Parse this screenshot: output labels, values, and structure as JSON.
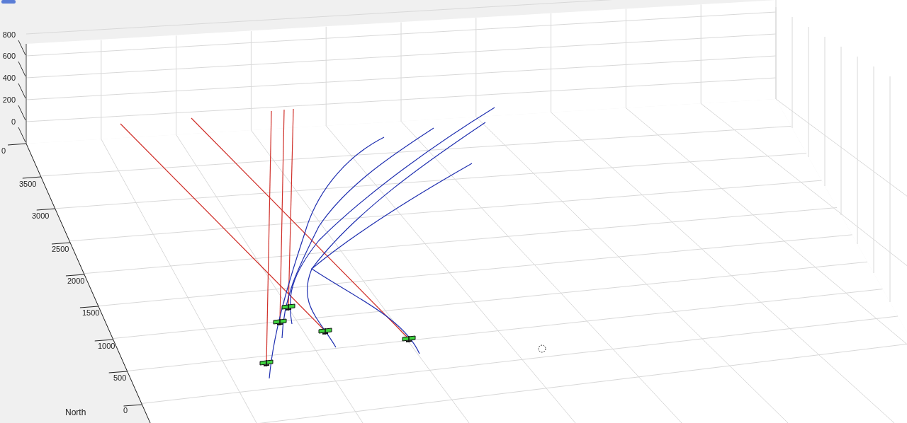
{
  "axes": {
    "z_ticks": [
      "800",
      "600",
      "400",
      "200",
      "0"
    ],
    "y_ticks": [
      "0",
      "3500",
      "3000",
      "2500",
      "2000",
      "1500",
      "1000",
      "500",
      "0"
    ],
    "y_label": "North"
  }
}
